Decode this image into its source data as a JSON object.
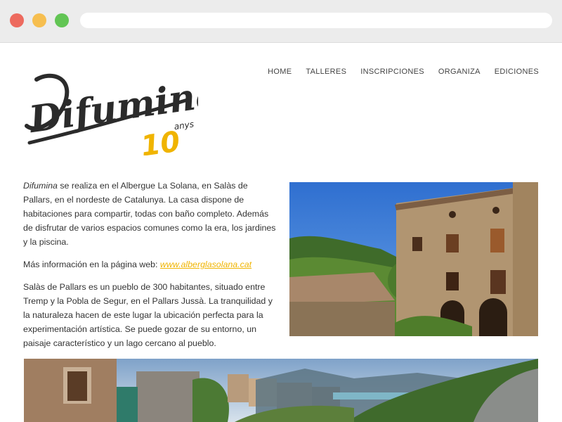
{
  "brand": {
    "name": "Difumina",
    "badge_number": "10",
    "badge_word": "anys"
  },
  "nav": {
    "items": [
      "HOME",
      "TALLERES",
      "INSCRIPCIONES",
      "ORGANIZA",
      "EDICIONES"
    ]
  },
  "content": {
    "p1_em": "Difumina",
    "p1_rest": " se realiza en el Albergue La Solana, en Salàs de Pallars, en el nordeste de Catalunya. La casa dispone de habitaciones para compartir, todas con baño completo. Además de disfrutar de varios espacios comunes como la era, los jardines y la piscina.",
    "p2_label": "Más información en la página web: ",
    "p2_link": "www.alberglasolana.cat",
    "p3": "Salàs de Pallars es un pueblo de 300 habitantes, situado entre Tremp y la Pobla de Segur, en el Pallars Jussà. La tranquilidad y la naturaleza hacen de este lugar la ubicación perfecta para la experimentación artística. Se puede gozar de su entorno, un paisaje característico y un lago cercano al pueblo."
  },
  "colors": {
    "accent_yellow": "#f0b400",
    "logo_dark": "#2b2b2b",
    "traffic_red": "#ed6a5e",
    "traffic_yellow": "#f6be4f",
    "traffic_green": "#62c554"
  }
}
